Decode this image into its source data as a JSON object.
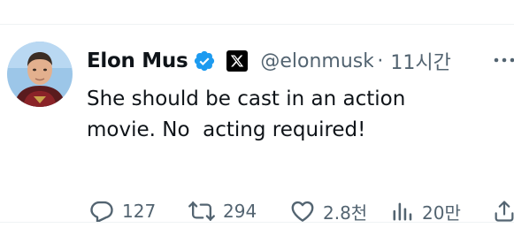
{
  "tweet": {
    "author": {
      "display_name": "Elon Mus",
      "handle": "@elonmusk",
      "verified_icon": "verified-badge-icon",
      "affiliate_icon": "x-logo-icon"
    },
    "separator": "·",
    "timestamp": "11시간",
    "text": "She should be cast in an action\nmovie. No  acting required!",
    "actions": {
      "reply_count": "127",
      "retweet_count": "294",
      "like_count": "2.8천",
      "view_count": "20만"
    }
  },
  "colors": {
    "text_primary": "#0f1419",
    "text_secondary": "#536471",
    "verified_blue": "#1d9bf0",
    "divider": "#eff3f4"
  }
}
